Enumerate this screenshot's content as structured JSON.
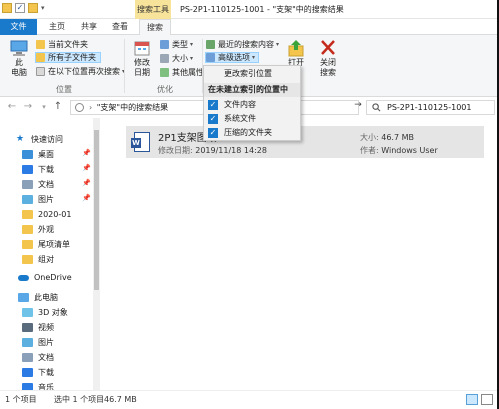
{
  "window": {
    "title": "PS-2P1-110125-1001 - \"支架\"中的搜索结果",
    "context_tab_header": "搜索工具"
  },
  "ribbon_tabs": {
    "file": "文件",
    "home": "主页",
    "share": "共享",
    "view": "查看",
    "search": "搜索"
  },
  "ribbon": {
    "location": {
      "computer": "此\n电脑",
      "current_folder": "当前文件夹",
      "all_subfolders": "所有子文件夹",
      "search_again_in": "在以下位置再次搜索",
      "group_label": "位置"
    },
    "options": {
      "modify_date": "修改\n日期",
      "kind": "类型",
      "size": "大小",
      "other_properties": "其他属性",
      "group_label": "优化"
    },
    "more": {
      "recent_searches": "最近的搜索内容",
      "advanced_options": "高级选项",
      "open": "打开",
      "close_search": "关闭\n搜索"
    }
  },
  "dropdown": {
    "change_indexed": "更改索引位置",
    "header": "在未建立索引的位置中",
    "items": [
      {
        "label": "文件内容",
        "checked": true
      },
      {
        "label": "系统文件",
        "checked": true
      },
      {
        "label": "压缩的文件夹",
        "checked": true
      }
    ]
  },
  "address": {
    "path": "\"支架\"中的搜索结果",
    "search_value": "PS-2P1-110125-1001"
  },
  "nav": {
    "quick_access": "快速访问",
    "items": [
      {
        "label": "桌面",
        "pinned": true,
        "icon": "desktop-icon"
      },
      {
        "label": "下载",
        "pinned": true,
        "icon": "download-icon"
      },
      {
        "label": "文档",
        "pinned": true,
        "icon": "documents-icon"
      },
      {
        "label": "图片",
        "pinned": true,
        "icon": "pictures-icon"
      },
      {
        "label": "2020-01",
        "pinned": false,
        "icon": "folder-icon"
      },
      {
        "label": "外观",
        "pinned": false,
        "icon": "folder-icon"
      },
      {
        "label": "尾项清单",
        "pinned": false,
        "icon": "folder-icon"
      },
      {
        "label": "组对",
        "pinned": false,
        "icon": "folder-icon"
      }
    ],
    "onedrive": "OneDrive",
    "this_pc": "此电脑",
    "pc_items": [
      {
        "label": "3D 对象",
        "icon": "3d-objects-icon"
      },
      {
        "label": "视频",
        "icon": "videos-icon"
      },
      {
        "label": "图片",
        "icon": "pictures-icon"
      },
      {
        "label": "文档",
        "icon": "documents-icon"
      },
      {
        "label": "下载",
        "icon": "download-icon"
      },
      {
        "label": "音乐",
        "icon": "music-icon"
      }
    ]
  },
  "result": {
    "name": "2P1支架图纸",
    "modified_label": "修改日期:",
    "modified_value": "2019/11/18 14:28",
    "size_label": "大小:",
    "size_value": "46.7 MB",
    "author_label": "作者:",
    "author_value": "Windows User"
  },
  "status": {
    "count": "1 个项目",
    "selected": "选中 1 个项目",
    "size": "46.7 MB"
  },
  "colors": {
    "accent": "#1979ca",
    "context_tab": "#f7e39a",
    "selection": "#cce8ff"
  }
}
